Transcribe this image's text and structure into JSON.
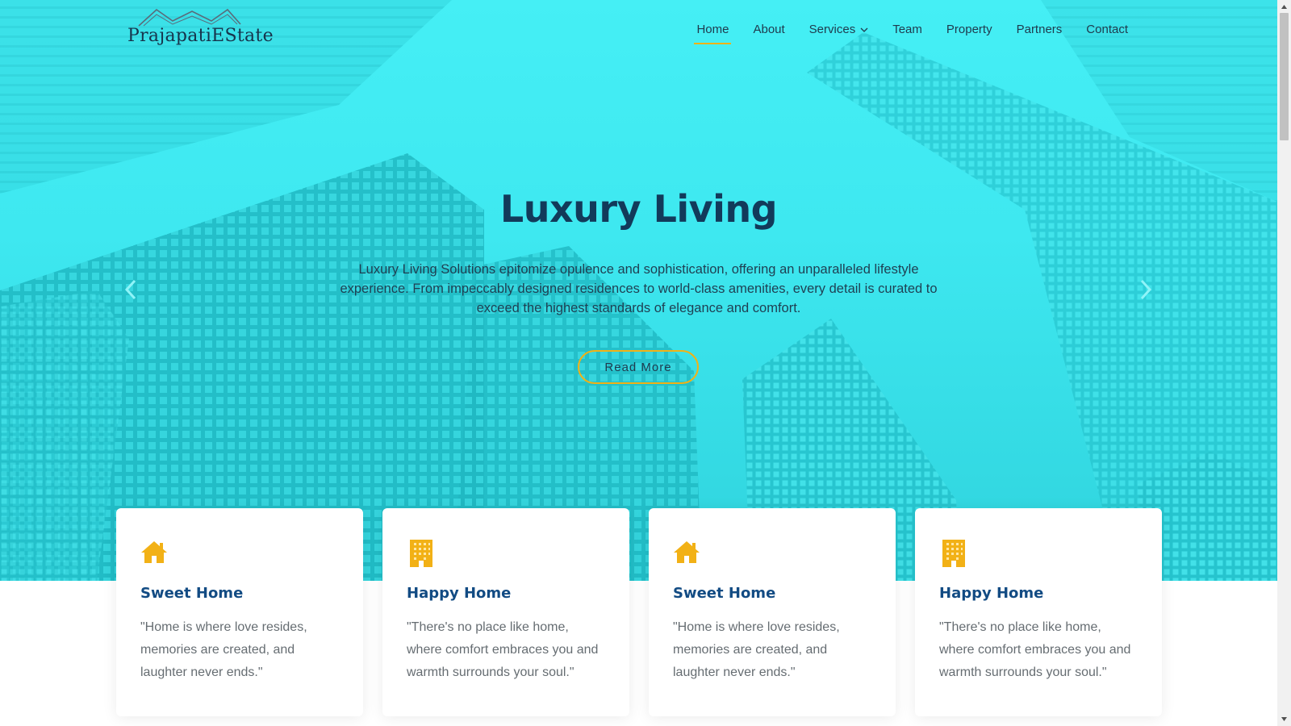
{
  "brand": {
    "name": "PrajapatiEState"
  },
  "nav": {
    "items": [
      {
        "label": "Home",
        "active": true
      },
      {
        "label": "About"
      },
      {
        "label": "Services",
        "dropdown": true
      },
      {
        "label": "Team"
      },
      {
        "label": "Property"
      },
      {
        "label": "Partners"
      },
      {
        "label": "Contact"
      }
    ]
  },
  "hero": {
    "title": "Luxury Living",
    "text": "Luxury Living Solutions epitomize opulence and sophistication, offering an unparalleled lifestyle experience. From impeccably designed residences to world-class amenities, every detail is curated to exceed the highest standards of elegance and comfort.",
    "button": "Read More",
    "prev_icon": "chevron-left-icon",
    "next_icon": "chevron-right-icon"
  },
  "cards": [
    {
      "icon": "house-icon",
      "title": "Sweet Home",
      "text": "\"Home is where love resides, memories are created, and laughter never ends.\""
    },
    {
      "icon": "building-icon",
      "title": "Happy Home",
      "text": "\"There's no place like home, where comfort embraces you and warmth surrounds your soul.\""
    },
    {
      "icon": "house-icon",
      "title": "Sweet Home",
      "text": "\"Home is where love resides, memories are created, and laughter never ends.\""
    },
    {
      "icon": "building-icon",
      "title": "Happy Home",
      "text": "\"There's no place like home, where comfort embraces you and warmth surrounds your soul.\""
    }
  ],
  "colors": {
    "accent": "#f2b116",
    "hero_bg": "#3ee8f0",
    "title": "#123a5a",
    "card_title": "#124b83"
  }
}
